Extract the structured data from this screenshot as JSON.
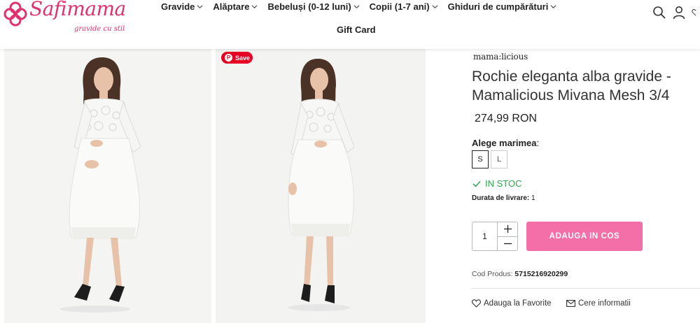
{
  "header": {
    "logo_text": "Safimama",
    "logo_tagline": "gravide cu stil",
    "nav": [
      {
        "label": "Gravide"
      },
      {
        "label": "Alăptare"
      },
      {
        "label": "Bebeluși (0-12 luni)"
      },
      {
        "label": "Copii (1-7 ani)"
      },
      {
        "label": "Ghiduri de cumpărături"
      }
    ],
    "nav_row2": "Gift Card",
    "icons": [
      "search-icon",
      "user-icon",
      "heart-icon"
    ]
  },
  "gallery": {
    "save_label": "Save"
  },
  "product": {
    "brand": "mama:licious",
    "title": "Rochie eleganta alba gravide - Mamalicious Mivana Mesh 3/4",
    "price": "274,99 RON",
    "size_label": "Alege marimea",
    "size_suffix": ":",
    "sizes": [
      {
        "label": "S",
        "selected": true
      },
      {
        "label": "L",
        "selected": false
      }
    ],
    "stock": "IN STOC",
    "delivery_label": "Durata de livrare:",
    "delivery_value": "1",
    "quantity": "1",
    "add_to_cart": "ADAUGA IN COS",
    "sku_label": "Cod Produs:",
    "sku_value": "5715216920299",
    "favorite": "Adauga la Favorite",
    "info": "Cere informatii"
  },
  "colors": {
    "brand_pink": "#e0306f",
    "cta_pink": "#f46ea7",
    "stock_green": "#2fa84f",
    "pinterest_red": "#e60023"
  }
}
